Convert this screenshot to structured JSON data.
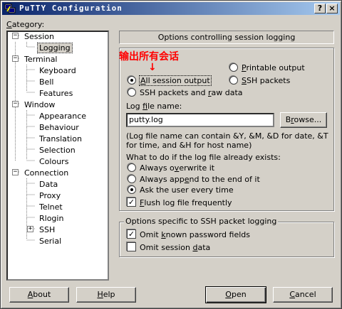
{
  "window": {
    "title": "PuTTY Configuration",
    "help_button": "?",
    "close_button": "×"
  },
  "category": {
    "label_prefix": "C",
    "label_rest": "ategory:"
  },
  "tree": [
    {
      "label": "Session",
      "expander": "−"
    },
    {
      "label": "Logging"
    },
    {
      "label": "Terminal",
      "expander": "−"
    },
    {
      "label": "Keyboard"
    },
    {
      "label": "Bell"
    },
    {
      "label": "Features"
    },
    {
      "label": "Window",
      "expander": "−"
    },
    {
      "label": "Appearance"
    },
    {
      "label": "Behaviour"
    },
    {
      "label": "Translation"
    },
    {
      "label": "Selection"
    },
    {
      "label": "Colours"
    },
    {
      "label": "Connection",
      "expander": "−"
    },
    {
      "label": "Data"
    },
    {
      "label": "Proxy"
    },
    {
      "label": "Telnet"
    },
    {
      "label": "Rlogin"
    },
    {
      "label": "SSH",
      "expander": "+"
    },
    {
      "label": "Serial"
    }
  ],
  "panel": {
    "heading": "Options controlling session logging",
    "annotation": "输出所有会话",
    "annotation_arrow": "↓",
    "logging_options": {
      "all_session_output": {
        "pre": "",
        "u": "A",
        "post": "ll session output"
      },
      "printable_output": {
        "pre": "",
        "u": "P",
        "post": "rintable output"
      },
      "ssh_packets": {
        "pre": "",
        "u": "S",
        "post": "SH packets"
      },
      "ssh_packets_raw": {
        "pre": "SSH packets and ",
        "u": "r",
        "post": "aw data"
      }
    },
    "log_file": {
      "label_pre": "Log ",
      "label_u": "f",
      "label_post": "ile name:",
      "value": "putty.log",
      "browse_pre": "B",
      "browse_u": "r",
      "browse_post": "owse..."
    },
    "note": "(Log file name can contain &Y, &M, &D for date, &T for time, and &H for host name)",
    "exists": {
      "label": "What to do if the log file already exists:",
      "overwrite": {
        "pre": "Always o",
        "u": "v",
        "post": "erwrite it"
      },
      "append": {
        "pre": "Always app",
        "u": "e",
        "post": "nd to the end of it"
      },
      "ask": {
        "pre": "Ask the user every time",
        "u": "",
        "post": ""
      }
    },
    "flush": {
      "pre": "",
      "u": "F",
      "post": "lush log file frequently"
    },
    "ssh_group": {
      "title": "Options specific to SSH packet logging",
      "omit_password": {
        "pre": "Omit ",
        "u": "k",
        "post": "nown password fields"
      },
      "omit_session": {
        "pre": "Omit session ",
        "u": "d",
        "post": "ata"
      }
    }
  },
  "state": {
    "selected_tree_item": "Logging",
    "logging_choice": "all_session_output",
    "exists_choice": "ask",
    "flush_checked": true,
    "omit_password_checked": true,
    "omit_session_checked": false
  },
  "buttons": {
    "about": {
      "u": "A",
      "post": "bout"
    },
    "help": {
      "u": "H",
      "post": "elp"
    },
    "open": {
      "u": "O",
      "post": "pen"
    },
    "cancel": {
      "u": "C",
      "post": "ancel"
    }
  },
  "colors": {
    "titlebar_start": "#0a246a",
    "titlebar_end": "#a6caf0",
    "face": "#d4d0c8",
    "annotation": "#ff0000"
  },
  "icons": {
    "app": "putty-computer-icon",
    "annotation_arrow": "down-arrow"
  }
}
